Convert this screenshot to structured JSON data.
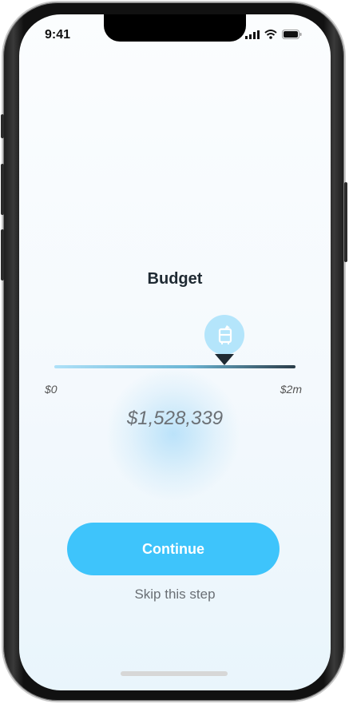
{
  "status_bar": {
    "time": "9:41",
    "icons": [
      "signal-icon",
      "wifi-icon",
      "battery-icon"
    ]
  },
  "screen": {
    "title": "Budget",
    "slider": {
      "min_label": "$0",
      "max_label": "$2m",
      "value": 0.71,
      "value_label": "$1,528,339",
      "thumb_icon": "fridge-icon"
    },
    "continue_label": "Continue",
    "skip_label": "Skip this step"
  },
  "colors": {
    "accent": "#3ec4fb",
    "thumb": "#b4e5fb",
    "dark": "#1f2a33",
    "track_start": "#aee1f8",
    "track_end": "#2b3d49"
  }
}
